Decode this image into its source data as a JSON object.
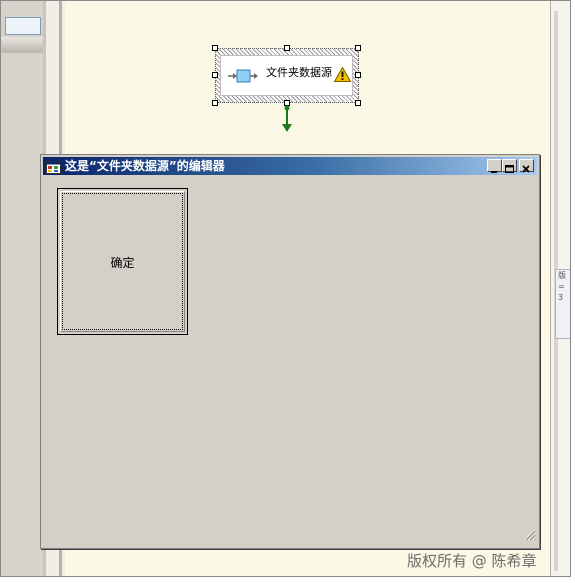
{
  "component": {
    "label": "文件夹数据源",
    "warning_icon": "warning-icon",
    "source_icon": "data-source-icon"
  },
  "editor": {
    "title": "这是“文件夹数据源”的编辑器",
    "ok_label": "确定",
    "minimize_icon": "minimize-icon",
    "maximize_icon": "maximize-icon",
    "close_icon": "close-icon"
  },
  "right_panel": {
    "lines": [
      "版",
      "=",
      "3"
    ]
  },
  "watermark": "版权所有 @ 陈希章",
  "colors": {
    "canvas": "#fbf8e5",
    "dialog": "#d4d0c8",
    "titlebar_start": "#0a246a",
    "titlebar_end": "#a6caf0",
    "connector": "#1a7a1a",
    "warning": "#f2c200"
  }
}
